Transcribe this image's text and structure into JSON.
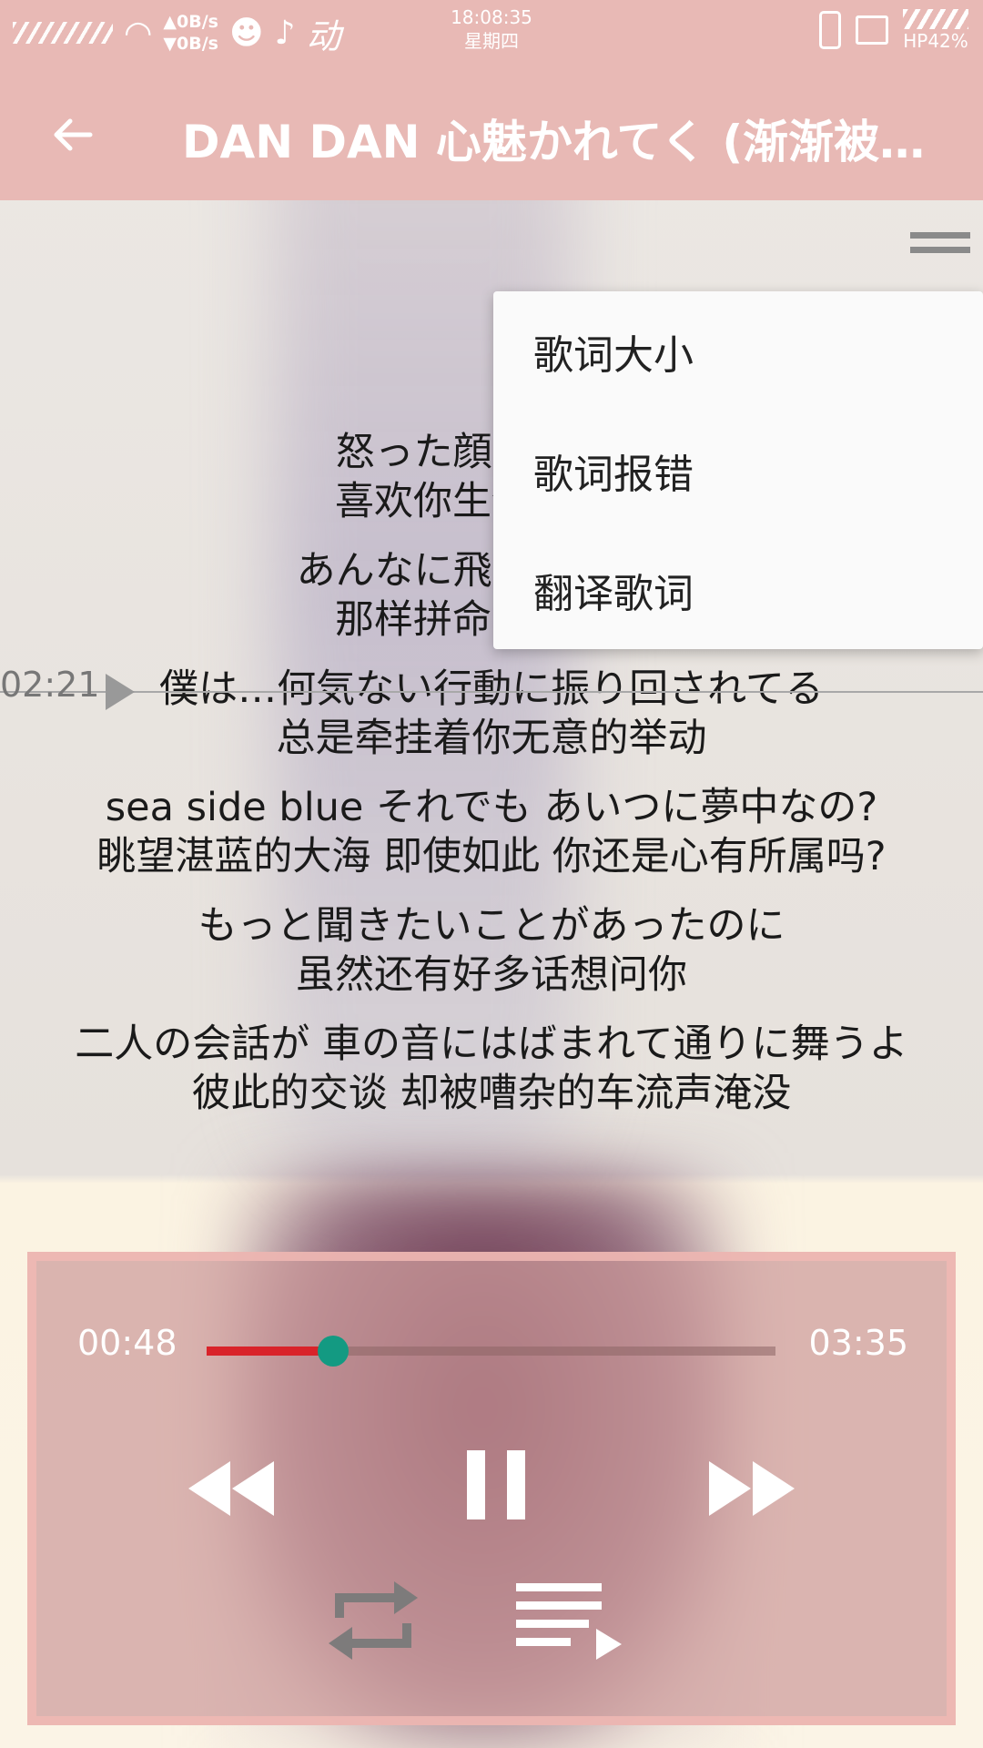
{
  "status_bar": {
    "net_up": "▲0B/s",
    "net_down": "▼0B/s",
    "time": "18:08:35",
    "weekday": "星期四",
    "battery": "HP42%"
  },
  "header": {
    "title": "DAN DAN 心魅かれてく (渐渐被…"
  },
  "lyrics": {
    "current_time": "02:21",
    "lines": [
      {
        "jp": "怒った顔も疲れて",
        "cn": "喜欢你生气的脸庞"
      },
      {
        "jp": "あんなに飛ばして生き",
        "cn": "那样拼命的生活方"
      },
      {
        "jp": "僕は…何気ない行動に振り回されてる",
        "cn": "总是牵挂着你无意的举动"
      },
      {
        "jp": "sea side blue それでも あいつに夢中なの?",
        "cn": "眺望湛蓝的大海  即使如此  你还是心有所属吗?"
      },
      {
        "jp": "もっと聞きたいことがあったのに",
        "cn": "虽然还有好多话想问你"
      },
      {
        "jp": "二人の会話が 車の音にはばまれて通りに舞うよ",
        "cn": "彼此的交谈  却被嘈杂的车流声淹没"
      }
    ]
  },
  "menu": {
    "items": [
      "歌词大小",
      "歌词报错",
      "翻译歌词"
    ]
  },
  "player": {
    "current": "00:48",
    "duration": "03:35",
    "progress": 0.223
  },
  "colors": {
    "bar": "#e8b9b5",
    "progress_fill": "#d9232a",
    "thumb": "#139a82"
  }
}
